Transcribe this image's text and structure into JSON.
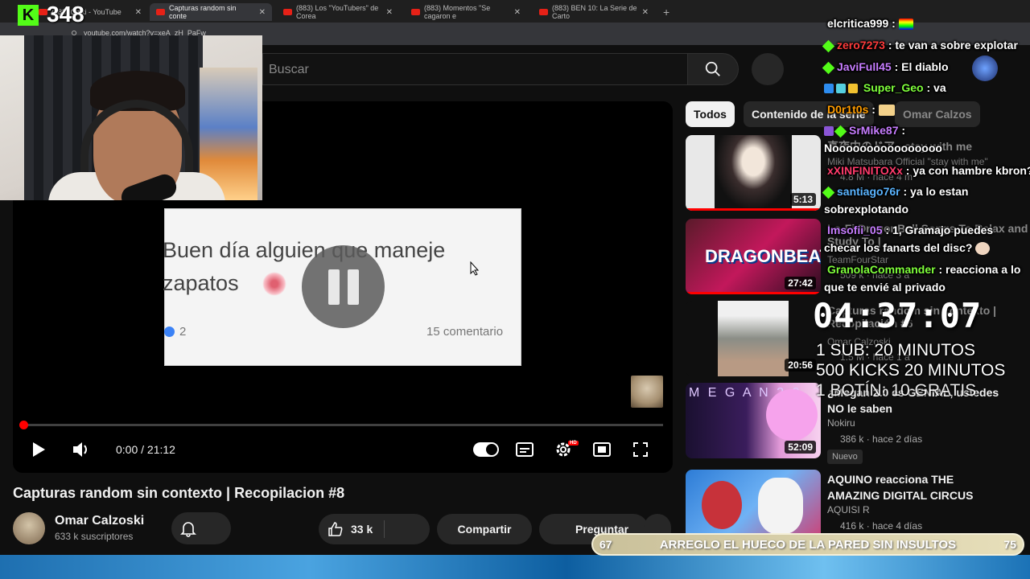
{
  "browser": {
    "tabs": [
      {
        "label": "(883) Chiki - YouTube"
      },
      {
        "label": "Capturas random sin conte"
      },
      {
        "label": "(883) Los \"YouTubers\" de Corea"
      },
      {
        "label": "(883) Momentos \"Se cagaron e"
      },
      {
        "label": "(883) BEN 10: La Serie de Carto"
      }
    ],
    "url": "youtube.com/watch?v=xeA_zH_PaFw"
  },
  "stream": {
    "viewer_count": "348",
    "kick_logo_letter": "K"
  },
  "search": {
    "placeholder": "Buscar"
  },
  "player": {
    "card_line1": "Buen día alguien que maneje",
    "card_line2": "zapatos",
    "card_reactions": "2",
    "card_comments": "15 comentario",
    "time": "0:00 / 21:12",
    "progress_fraction": 0.0
  },
  "video": {
    "title": "Capturas random sin contexto | Recopilacion #8",
    "channel": "Omar Calzoski",
    "subscribers": "633 k suscriptores",
    "likes": "33 k",
    "share_label": "Compartir",
    "ask_label": "Preguntar"
  },
  "sidebar": {
    "chips": [
      "Todos",
      "Contenido de la serie",
      "Omar Calzos"
    ],
    "recommendations": [
      {
        "duration": "5:13",
        "title": "真夜中のドア ~stay with me",
        "channel": "Miki Matsubara Official \"stay with me\"",
        "meta": "4.8 M · hace 4 m"
      },
      {
        "duration": "27:42",
        "title": "Lo-Fi DragonBall Songs To Relax and Study To |",
        "channel": "TeamFourStar",
        "meta": "509 k · hace 3 a"
      },
      {
        "duration": "20:56",
        "title": "Capturas random sin contexto | Recopilación #6",
        "channel": "Omar Calzoski",
        "meta": "1.5 M · hace 1 a"
      },
      {
        "duration": "52:09",
        "title": "¿Megan 2.0 es GENIAL, ustedes NO le saben",
        "channel": "Nokiru",
        "meta": "386 k · hace 2 días",
        "badge": "Nuevo"
      },
      {
        "duration": "",
        "title": "AQUINO reacciona THE AMAZING DIGITAL CIRCUS",
        "channel": "AQUISI R",
        "meta": "416 k · hace 4 días"
      }
    ]
  },
  "chat": [
    {
      "user": "elcritica999",
      "message": "",
      "color": "#ffffff"
    },
    {
      "user": "zero7273",
      "message": "te van a sobre explotar",
      "color": "#ff3b3b"
    },
    {
      "user": "JaviFull45",
      "message": "El diablo",
      "color": "#c77dff"
    },
    {
      "user": "Super_Geo",
      "message": "va",
      "color": "#7fff3b"
    },
    {
      "user": "D0r1t0s",
      "message": "",
      "color": "#ff9d00"
    },
    {
      "user": "SrMike87",
      "message": "",
      "color": "#c77dff"
    },
    {
      "user": "",
      "message": "Noooooooooooooooo",
      "color": "#ffffff"
    },
    {
      "user": "xXINFINITOXx",
      "message": "ya con hambre kbron?",
      "color": "#ff3b6b"
    },
    {
      "user": "santiago76r",
      "message": "ya lo estan",
      "color": "#5ab4ff"
    },
    {
      "user": "",
      "message": "sobrexplotando",
      "color": "#ffffff"
    },
    {
      "user": "Imsofii_05",
      "message": "1, Gramajo puedes",
      "color": "#c77dff"
    },
    {
      "user": "",
      "message": "checar los fanarts del disc?",
      "color": "#ffffff"
    },
    {
      "user": "GranolaCommander",
      "message": "reacciona a lo",
      "color": "#7fff3b"
    },
    {
      "user": "",
      "message": "que te envié al privado",
      "color": "#ffffff"
    }
  ],
  "overlay": {
    "timer": "04:37:07",
    "goal_line1": "1 SUB: 20  MINUTOS",
    "goal_line2": "500 KICKS 20 MINUTOS",
    "goal_line3": "1 BOTÍN: 10 GRATIS",
    "goalbar_left": "67",
    "goalbar_title": "ARREGLO EL HUECO DE LA PARED SIN INSULTOS",
    "goalbar_right": "75"
  },
  "colors": {
    "youtube_red": "#ff0000",
    "kick_green": "#53fc18",
    "background": "#0f0f0f"
  }
}
